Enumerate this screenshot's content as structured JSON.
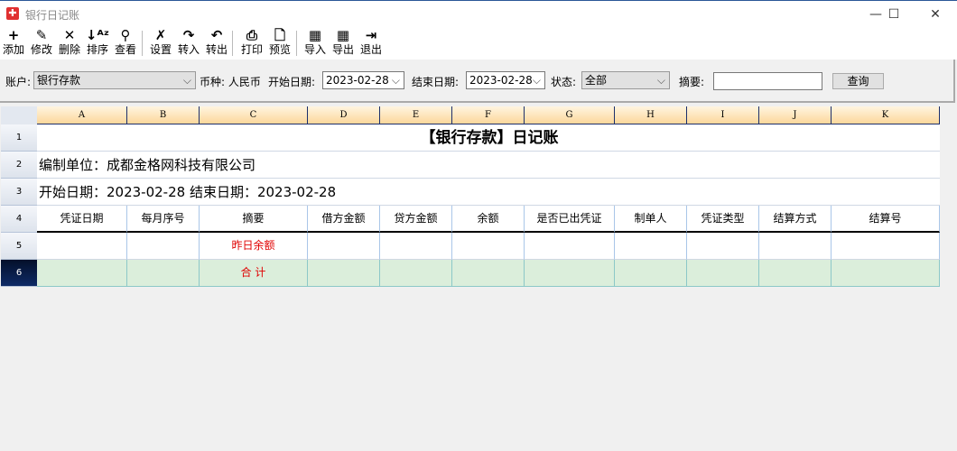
{
  "window": {
    "title": "银行日记账",
    "minimize": "—",
    "maximize": "☐",
    "close": "✕"
  },
  "toolbar": [
    {
      "label": "添加",
      "icon": "plus-icon",
      "glyph": "+"
    },
    {
      "label": "修改",
      "icon": "pencil-icon",
      "glyph": "✎"
    },
    {
      "label": "删除",
      "icon": "x-icon",
      "glyph": "✕"
    },
    {
      "label": "排序",
      "icon": "sort-az-icon",
      "glyph": "↓ᴬᶻ"
    },
    {
      "label": "查看",
      "icon": "search-icon",
      "glyph": "⚲"
    },
    {
      "label": "设置",
      "icon": "wrench-icon",
      "glyph": "✗"
    },
    {
      "label": "转入",
      "icon": "redo-arrow-icon",
      "glyph": "↷"
    },
    {
      "label": "转出",
      "icon": "export-arrow-icon",
      "glyph": "↶"
    },
    {
      "label": "打印",
      "icon": "printer-icon",
      "glyph": "⎙"
    },
    {
      "label": "预览",
      "icon": "preview-icon",
      "glyph": "🗋"
    },
    {
      "label": "导入",
      "icon": "import-icon",
      "glyph": "▦"
    },
    {
      "label": "导出",
      "icon": "export-icon",
      "glyph": "▦"
    },
    {
      "label": "退出",
      "icon": "exit-icon",
      "glyph": "⇥"
    }
  ],
  "filter": {
    "account_label": "账户:",
    "account_value": "银行存款",
    "currency": "币种: 人民币",
    "start_label": "开始日期:",
    "start_value": "2023-02-28",
    "end_label": "结束日期:",
    "end_value": "2023-02-28",
    "status_label": "状态:",
    "status_value": "全部",
    "summary_label": "摘要:",
    "summary_value": "",
    "query_button": "查询"
  },
  "grid": {
    "columns": [
      "A",
      "B",
      "C",
      "D",
      "E",
      "F",
      "G",
      "H",
      "I",
      "J",
      "K"
    ],
    "rows": [
      "1",
      "2",
      "3",
      "4",
      "5",
      "6"
    ],
    "title": "【银行存款】日记账",
    "unit": "编制单位：成都金格网科技有限公司",
    "dates": "开始日期：2023-02-28 结束日期：2023-02-28",
    "headers": [
      "凭证日期",
      "每月序号",
      "摘要",
      "借方金额",
      "贷方金额",
      "余额",
      "是否已出凭证",
      "制单人",
      "凭证类型",
      "结算方式",
      "结算号"
    ],
    "row5": [
      "",
      "",
      "昨日余额",
      "",
      "",
      "",
      "",
      "",
      "",
      "",
      ""
    ],
    "row6": [
      "",
      "",
      "合  计",
      "",
      "",
      "",
      "",
      "",
      "",
      "",
      ""
    ]
  },
  "colors": {
    "accent_red": "#e00000",
    "total_row": "#dbeedb",
    "header_orange": "#fcd79b"
  }
}
